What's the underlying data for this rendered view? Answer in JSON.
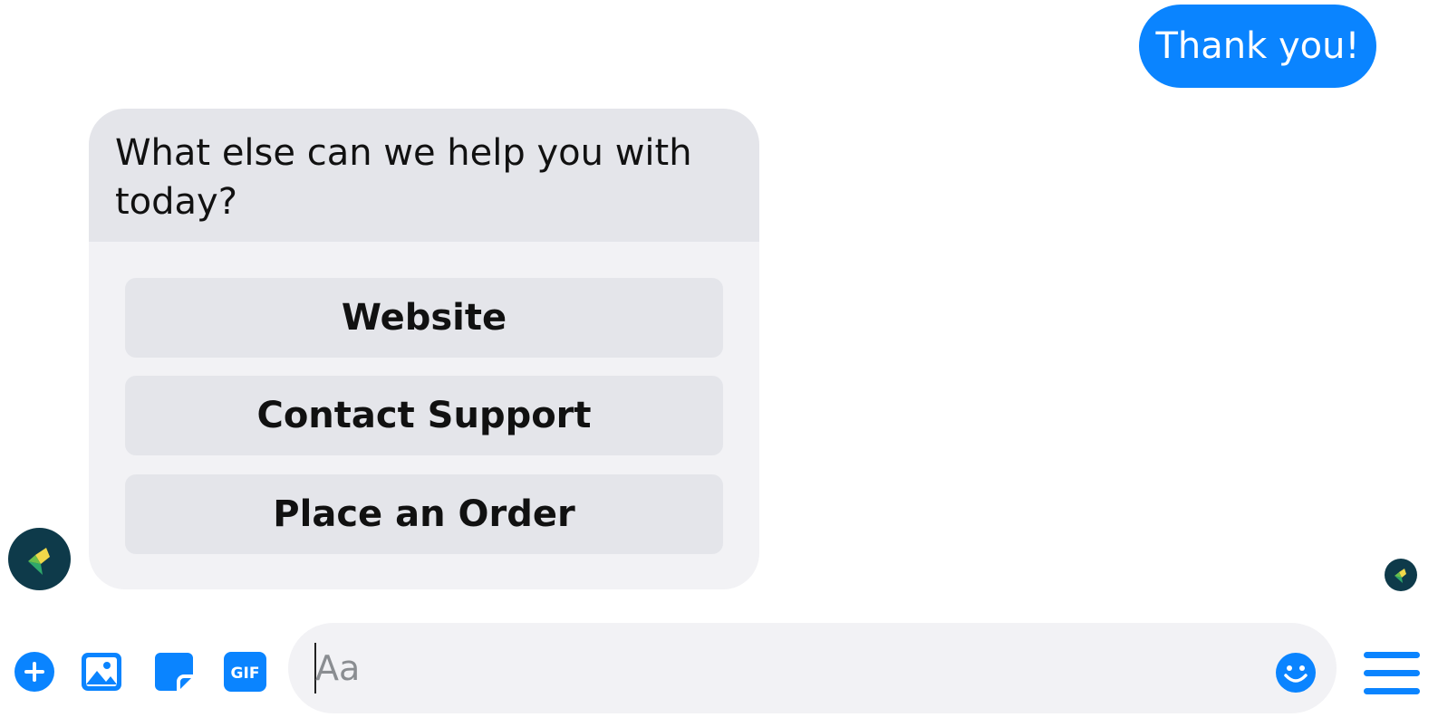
{
  "conversation": {
    "sent_message": "Thank you!",
    "bot_message": "What else can we help you with today?",
    "quick_replies": [
      {
        "label": "Website"
      },
      {
        "label": "Contact Support"
      },
      {
        "label": "Place an Order"
      }
    ]
  },
  "composer": {
    "placeholder": "Aa",
    "value": ""
  },
  "toolbar": {
    "icons": [
      "plus-icon",
      "image-icon",
      "sticker-icon",
      "gif-icon"
    ],
    "gif_label": "GIF"
  },
  "colors": {
    "accent": "#0a84ff",
    "bot_header_bg": "#e4e5ea",
    "bot_card_bg": "#f2f2f5",
    "avatar_bg": "#0e3a4a"
  }
}
